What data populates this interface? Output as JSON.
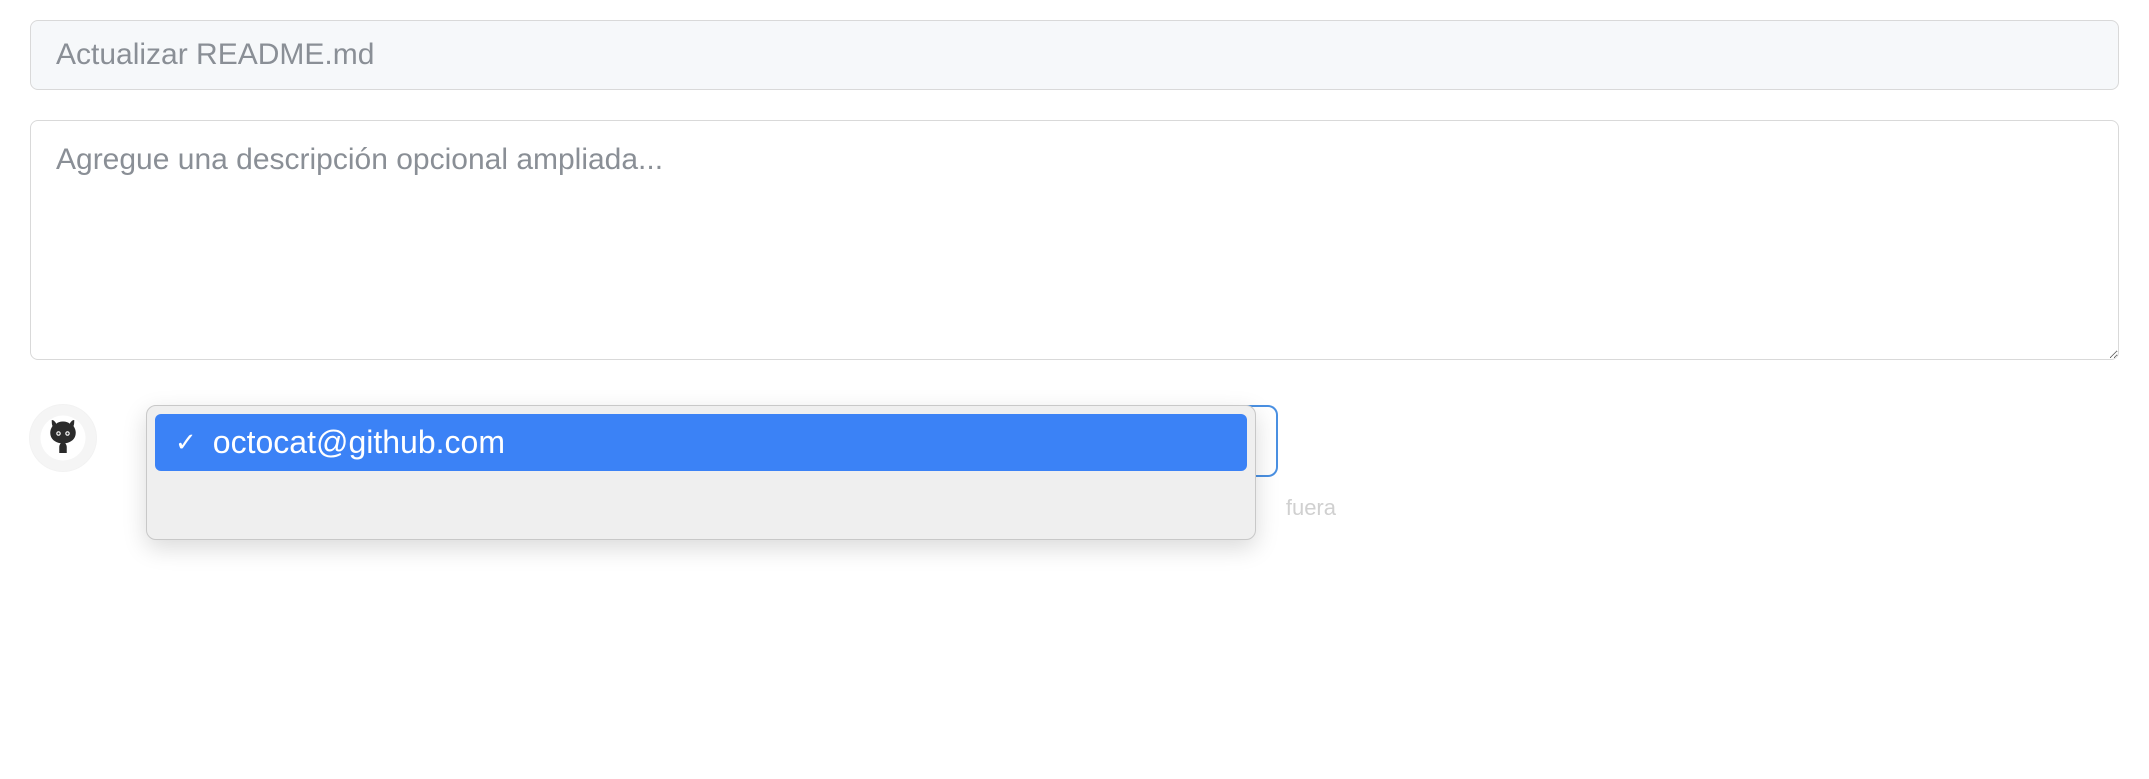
{
  "commit": {
    "summary_placeholder": "Actualizar README.md",
    "summary_value": "",
    "description_placeholder": "Agregue una descripción opcional ampliada...",
    "description_value": ""
  },
  "author_dropdown": {
    "selected_email": "octocat@github.com",
    "check_glyph": "✓"
  },
  "faint_text": "fuera",
  "colors": {
    "highlight": "#3b82f6",
    "input_bg": "#f6f8fa",
    "border": "#d9d9d9"
  }
}
